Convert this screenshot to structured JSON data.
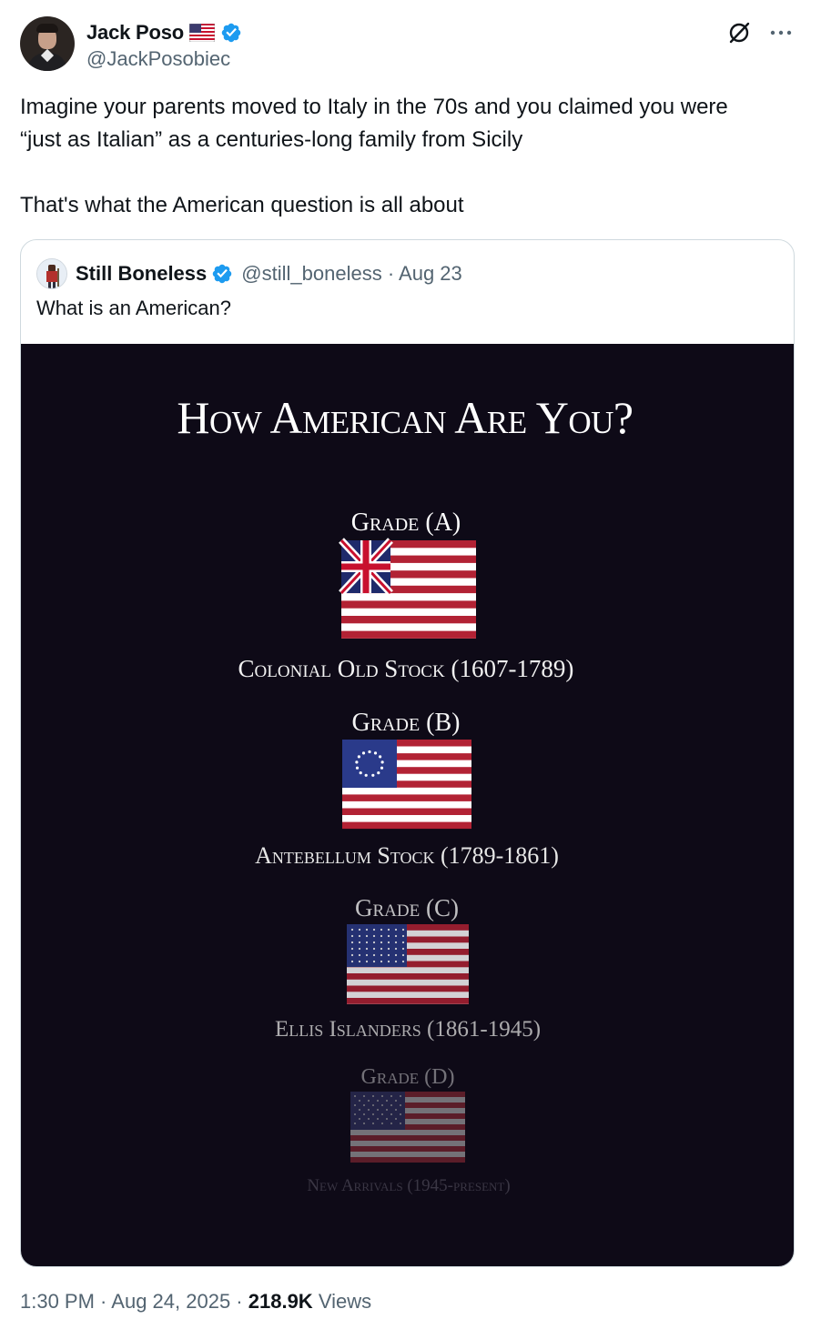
{
  "author": {
    "display_name": "Jack Poso",
    "handle": "@JackPosobiec"
  },
  "tweet": {
    "line1": "Imagine your parents moved to Italy in the 70s and you claimed you were",
    "line2": "“just as Italian” as a centuries-long family from Sicily",
    "line3": "That's what the American question is all about"
  },
  "quote": {
    "display_name": "Still Boneless",
    "handle": "@still_boneless",
    "date": "Aug 23",
    "text": "What is an American?"
  },
  "infographic": {
    "title": "How American Are You?",
    "grades": [
      {
        "grade": "Grade (A)",
        "caption": "Colonial Old Stock (1607-1789)",
        "flag": "grand-union-flag"
      },
      {
        "grade": "Grade (B)",
        "caption": "Antebellum Stock (1789-1861)",
        "flag": "betsy-ross-flag"
      },
      {
        "grade": "Grade (C)",
        "caption": "Ellis Islanders (1861-1945)",
        "flag": "48-star-flag"
      },
      {
        "grade": "Grade (D)",
        "caption": "New Arrivals (1945-present)",
        "flag": "50-star-flag"
      }
    ]
  },
  "footer": {
    "time": "1:30 PM",
    "date": "Aug 24, 2025",
    "views_count": "218.9K",
    "views_label": "Views"
  },
  "colors": {
    "verified": "#1d9bf0",
    "muted": "#536471",
    "panel_bg": "#0e0a17",
    "flag_red": "#b22234",
    "flag_blue": "#3c3b6e"
  }
}
